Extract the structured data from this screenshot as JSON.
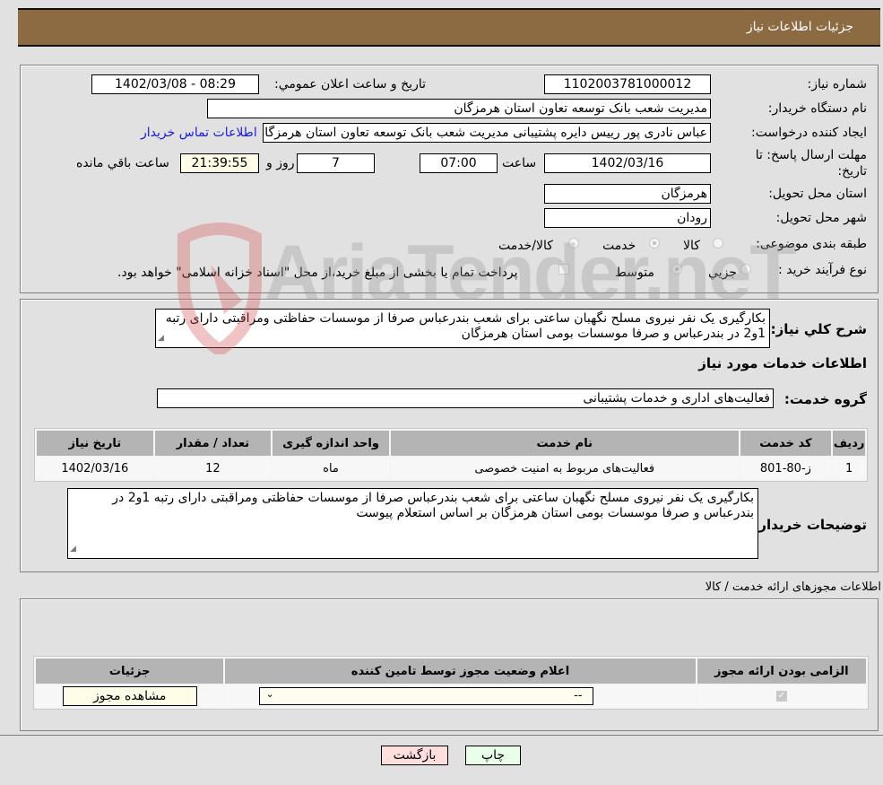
{
  "header": {
    "title": "جزئیات اطلاعات نیاز"
  },
  "form": {
    "need_number_label": "شماره نیاز:",
    "need_number": "1102003781000012",
    "announce_label": "تاریخ و ساعت اعلان عمومي:",
    "announce_value": "1402/03/08 - 08:29",
    "buyer_org_label": "نام دستگاه خریدار:",
    "buyer_org": "مدیریت شعب بانک توسعه تعاون استان هرمزگان",
    "creator_label": "ایجاد کننده درخواست:",
    "creator": "عباس نادری پور رییس دایره پشتیبانی مدیریت شعب بانک توسعه تعاون استان هرمزگان",
    "buyer_contact_link": "اطلاعات تماس خریدار",
    "deadline_label_1": "مهلت ارسال پاسخ: تا",
    "deadline_label_2": "تاریخ:",
    "deadline_date": "1402/03/16",
    "time_label": "ساعت",
    "deadline_time": "07:00",
    "days_value": "7",
    "days_label": "روز و",
    "remaining_time": "21:39:55",
    "remaining_label": "ساعت باقي مانده",
    "province_label": "استان محل تحویل:",
    "province": "هرمزگان",
    "city_label": "شهر محل تحویل:",
    "city": "رودان",
    "category_label": "طبقه بندی موضوعی:",
    "category_options": [
      {
        "label": "کالا",
        "checked": false
      },
      {
        "label": "خدمت",
        "checked": true
      },
      {
        "label": "کالا/خدمت",
        "checked": false
      }
    ],
    "process_label": "نوع فرآیند خرید :",
    "process_options": [
      {
        "label": "جزيي",
        "checked": false
      },
      {
        "label": "متوسط",
        "checked": true
      }
    ],
    "treasury_checkbox_label": "پرداخت تمام یا بخشی از مبلغ خرید،از محل \"اسناد خزانه اسلامی\" خواهد بود.",
    "treasury_checked": false
  },
  "description": {
    "label": "شرح کلي نیاز:",
    "text": "بکارگیری یک نفر نیروی مسلح نگهبان ساعتی برای شعب بندرعباس صرفا از موسسات حفاظتی ومراقبتی دارای رتبه 1و2 در بندرعباس و صرفا موسسات بومی استان هرمزگان"
  },
  "services": {
    "section_title": "اطلاعات خدمات مورد نیاز",
    "group_label": "گروه خدمت:",
    "group_value": "فعالیت‌های اداری و خدمات پشتیبانی",
    "columns": [
      "ردیف",
      "کد خدمت",
      "نام خدمت",
      "واحد اندازه گیری",
      "تعداد / مقدار",
      "تاریخ نیاز"
    ],
    "rows": [
      [
        "1",
        "ز-80-801",
        "فعالیت‌های مربوط به امنیت خصوصی",
        "ماه",
        "12",
        "1402/03/16"
      ]
    ]
  },
  "buyer_notes": {
    "label": "توضیحات خریدار:",
    "text": "بکارگیری یک نفر نیروی مسلح نگهبان ساعتی برای شعب بندرعباس صرفا از موسسات حفاظتی ومراقبتی دارای رتبه 1و2 در بندرعباس و صرفا موسسات بومی استان هرمزگان بر اساس استعلام پیوست"
  },
  "permits": {
    "section_title": "اطلاعات مجوزهای ارائه خدمت / کالا",
    "columns": [
      "الزامی بودن ارائه مجوز",
      "اعلام وضعیت مجوز توسط تامین کننده",
      "جزئیات"
    ],
    "row": {
      "required_checked": true,
      "status_select_value": "--",
      "details_button": "مشاهده مجوز"
    }
  },
  "footer": {
    "print_button": "چاپ",
    "back_button": "بازگشت"
  },
  "watermark": {
    "text": "AriaTender.neT"
  }
}
